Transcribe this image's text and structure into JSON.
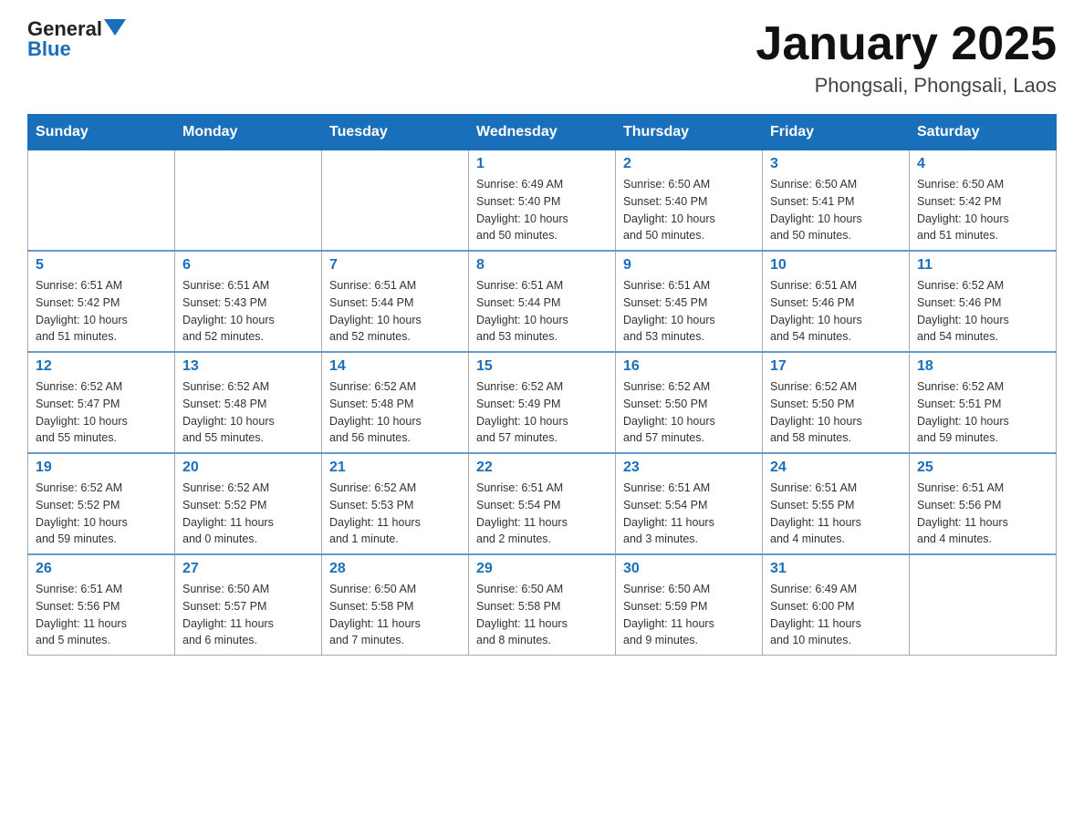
{
  "header": {
    "logo_text_black": "General",
    "logo_text_blue": "Blue",
    "title": "January 2025",
    "subtitle": "Phongsali, Phongsali, Laos"
  },
  "days_of_week": [
    "Sunday",
    "Monday",
    "Tuesday",
    "Wednesday",
    "Thursday",
    "Friday",
    "Saturday"
  ],
  "weeks": [
    [
      {
        "day": "",
        "info": ""
      },
      {
        "day": "",
        "info": ""
      },
      {
        "day": "",
        "info": ""
      },
      {
        "day": "1",
        "info": "Sunrise: 6:49 AM\nSunset: 5:40 PM\nDaylight: 10 hours\nand 50 minutes."
      },
      {
        "day": "2",
        "info": "Sunrise: 6:50 AM\nSunset: 5:40 PM\nDaylight: 10 hours\nand 50 minutes."
      },
      {
        "day": "3",
        "info": "Sunrise: 6:50 AM\nSunset: 5:41 PM\nDaylight: 10 hours\nand 50 minutes."
      },
      {
        "day": "4",
        "info": "Sunrise: 6:50 AM\nSunset: 5:42 PM\nDaylight: 10 hours\nand 51 minutes."
      }
    ],
    [
      {
        "day": "5",
        "info": "Sunrise: 6:51 AM\nSunset: 5:42 PM\nDaylight: 10 hours\nand 51 minutes."
      },
      {
        "day": "6",
        "info": "Sunrise: 6:51 AM\nSunset: 5:43 PM\nDaylight: 10 hours\nand 52 minutes."
      },
      {
        "day": "7",
        "info": "Sunrise: 6:51 AM\nSunset: 5:44 PM\nDaylight: 10 hours\nand 52 minutes."
      },
      {
        "day": "8",
        "info": "Sunrise: 6:51 AM\nSunset: 5:44 PM\nDaylight: 10 hours\nand 53 minutes."
      },
      {
        "day": "9",
        "info": "Sunrise: 6:51 AM\nSunset: 5:45 PM\nDaylight: 10 hours\nand 53 minutes."
      },
      {
        "day": "10",
        "info": "Sunrise: 6:51 AM\nSunset: 5:46 PM\nDaylight: 10 hours\nand 54 minutes."
      },
      {
        "day": "11",
        "info": "Sunrise: 6:52 AM\nSunset: 5:46 PM\nDaylight: 10 hours\nand 54 minutes."
      }
    ],
    [
      {
        "day": "12",
        "info": "Sunrise: 6:52 AM\nSunset: 5:47 PM\nDaylight: 10 hours\nand 55 minutes."
      },
      {
        "day": "13",
        "info": "Sunrise: 6:52 AM\nSunset: 5:48 PM\nDaylight: 10 hours\nand 55 minutes."
      },
      {
        "day": "14",
        "info": "Sunrise: 6:52 AM\nSunset: 5:48 PM\nDaylight: 10 hours\nand 56 minutes."
      },
      {
        "day": "15",
        "info": "Sunrise: 6:52 AM\nSunset: 5:49 PM\nDaylight: 10 hours\nand 57 minutes."
      },
      {
        "day": "16",
        "info": "Sunrise: 6:52 AM\nSunset: 5:50 PM\nDaylight: 10 hours\nand 57 minutes."
      },
      {
        "day": "17",
        "info": "Sunrise: 6:52 AM\nSunset: 5:50 PM\nDaylight: 10 hours\nand 58 minutes."
      },
      {
        "day": "18",
        "info": "Sunrise: 6:52 AM\nSunset: 5:51 PM\nDaylight: 10 hours\nand 59 minutes."
      }
    ],
    [
      {
        "day": "19",
        "info": "Sunrise: 6:52 AM\nSunset: 5:52 PM\nDaylight: 10 hours\nand 59 minutes."
      },
      {
        "day": "20",
        "info": "Sunrise: 6:52 AM\nSunset: 5:52 PM\nDaylight: 11 hours\nand 0 minutes."
      },
      {
        "day": "21",
        "info": "Sunrise: 6:52 AM\nSunset: 5:53 PM\nDaylight: 11 hours\nand 1 minute."
      },
      {
        "day": "22",
        "info": "Sunrise: 6:51 AM\nSunset: 5:54 PM\nDaylight: 11 hours\nand 2 minutes."
      },
      {
        "day": "23",
        "info": "Sunrise: 6:51 AM\nSunset: 5:54 PM\nDaylight: 11 hours\nand 3 minutes."
      },
      {
        "day": "24",
        "info": "Sunrise: 6:51 AM\nSunset: 5:55 PM\nDaylight: 11 hours\nand 4 minutes."
      },
      {
        "day": "25",
        "info": "Sunrise: 6:51 AM\nSunset: 5:56 PM\nDaylight: 11 hours\nand 4 minutes."
      }
    ],
    [
      {
        "day": "26",
        "info": "Sunrise: 6:51 AM\nSunset: 5:56 PM\nDaylight: 11 hours\nand 5 minutes."
      },
      {
        "day": "27",
        "info": "Sunrise: 6:50 AM\nSunset: 5:57 PM\nDaylight: 11 hours\nand 6 minutes."
      },
      {
        "day": "28",
        "info": "Sunrise: 6:50 AM\nSunset: 5:58 PM\nDaylight: 11 hours\nand 7 minutes."
      },
      {
        "day": "29",
        "info": "Sunrise: 6:50 AM\nSunset: 5:58 PM\nDaylight: 11 hours\nand 8 minutes."
      },
      {
        "day": "30",
        "info": "Sunrise: 6:50 AM\nSunset: 5:59 PM\nDaylight: 11 hours\nand 9 minutes."
      },
      {
        "day": "31",
        "info": "Sunrise: 6:49 AM\nSunset: 6:00 PM\nDaylight: 11 hours\nand 10 minutes."
      },
      {
        "day": "",
        "info": ""
      }
    ]
  ]
}
